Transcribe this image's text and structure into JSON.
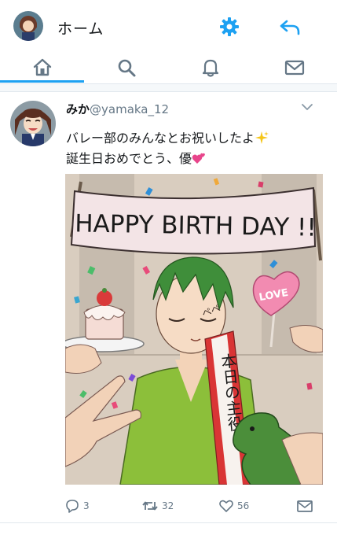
{
  "header": {
    "title": "ホーム",
    "avatar_icon": "profile-avatar",
    "settings_icon": "gear-icon",
    "back_icon": "back-arrow-icon"
  },
  "tabs": [
    {
      "icon": "home-icon",
      "active": true
    },
    {
      "icon": "search-icon",
      "active": false
    },
    {
      "icon": "bell-icon",
      "active": false
    },
    {
      "icon": "mail-icon",
      "active": false
    }
  ],
  "tweet": {
    "display_name": "みか",
    "handle": "@yamaka_12",
    "line1": "バレー部のみんなとお祝いしたよ",
    "line2": "誕生日おめでとう、優",
    "image": {
      "banner_text": "HAPPY BIRTH DAY !!",
      "sash_text": "本日の主役",
      "cheek_text": "ペペ",
      "heart_sign_text": "LOVE"
    },
    "actions": {
      "replies": "3",
      "retweets": "32",
      "likes": "56"
    }
  },
  "colors": {
    "accent": "#1da1f2",
    "text": "#14171a",
    "muted": "#657786",
    "divider": "#e1e8ed"
  }
}
